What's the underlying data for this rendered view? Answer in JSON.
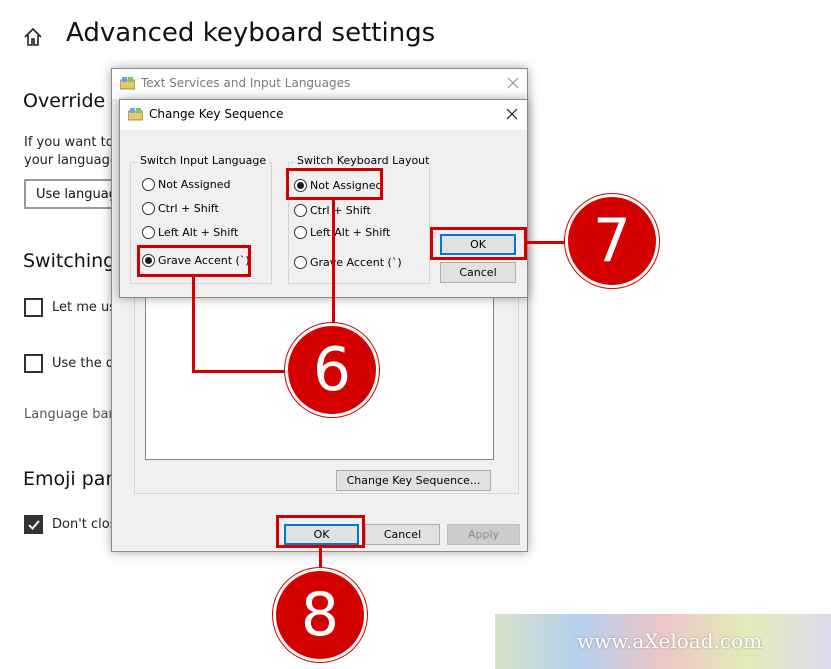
{
  "settings": {
    "title": "Advanced keyboard settings",
    "override_heading": "Override f",
    "if_you_want": "If you want to",
    "your_language": "your language",
    "dropdown_value": "Use languag",
    "switching_heading": "Switching",
    "let_me_use": "Let me us",
    "use_the_d": "Use the d",
    "language_bar": "Language bar",
    "emoji_heading": "Emoji pane",
    "dont_close": "Don't clos"
  },
  "outer_dialog": {
    "title": "Text Services and Input Languages",
    "change_key_sequence_btn": "Change Key Sequence...",
    "ok": "OK",
    "cancel": "Cancel",
    "apply": "Apply"
  },
  "inner_dialog": {
    "title": "Change Key Sequence",
    "input_language_group": "Switch Input Language",
    "input_language_options": [
      "Not Assigned",
      "Ctrl + Shift",
      "Left Alt + Shift",
      "Grave Accent (`)"
    ],
    "input_language_selected": 3,
    "keyboard_layout_group": "Switch Keyboard Layout",
    "keyboard_layout_options": [
      "Not Assigned",
      "Ctrl + Shift",
      "Left Alt + Shift",
      "Grave Accent (`)"
    ],
    "keyboard_layout_selected": 0,
    "ok": "OK",
    "cancel": "Cancel"
  },
  "annotations": {
    "step6": "6",
    "step7": "7",
    "step8": "8"
  },
  "watermark": "www.aXeload.com",
  "colors": {
    "annotation_red": "#d40000",
    "default_button_blue": "#0078d7",
    "dialog_bg": "#f0f0f0"
  },
  "icons": [
    "home-icon",
    "app-icon",
    "close-icon",
    "checkmark-icon"
  ]
}
